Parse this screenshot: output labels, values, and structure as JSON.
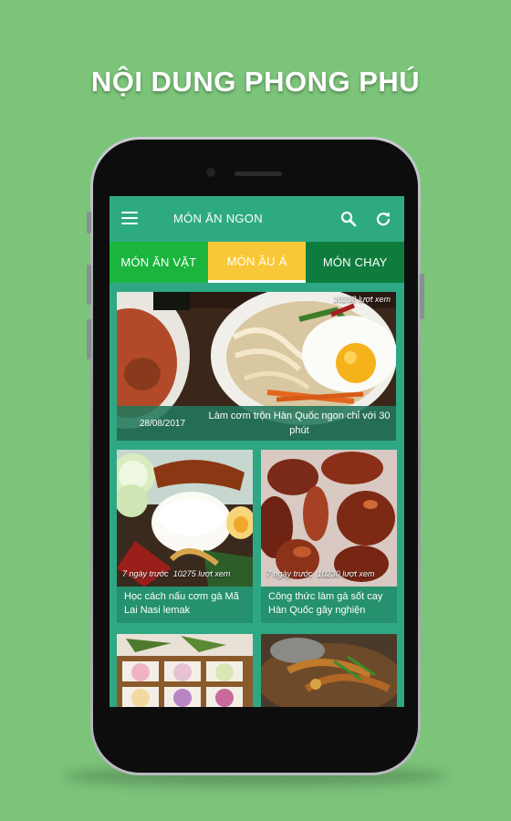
{
  "promo": {
    "headline": "NỘI DUNG PHONG PHÚ"
  },
  "app": {
    "title": "MÓN ĂN NGON",
    "tabs": [
      {
        "label": "MÓN ĂN VẶT",
        "color": "#1bb53d"
      },
      {
        "label": "MÓN ÂU Á",
        "color": "#f8c838",
        "selected": true
      },
      {
        "label": "MÓN CHAY",
        "color": "#0e7c3c"
      }
    ],
    "accent": "#2eaa82"
  },
  "featured": {
    "views": "10238 lượt xem",
    "date": "28/08/2017",
    "title": "Làm cơm trộn Hàn Quốc ngon chỉ với 30 phút"
  },
  "articles": [
    {
      "time": "7 ngày trước",
      "views": "10275 lượt xem",
      "title": "Học cách nấu cơm gà Mã Lai Nasi lemak"
    },
    {
      "time": "7 ngày trước",
      "views": "10230 lượt xem",
      "title": "Công thức làm gà sốt cay Hàn Quốc gây nghiện"
    }
  ],
  "icons": [
    "menu-icon",
    "search-icon",
    "refresh-icon"
  ]
}
